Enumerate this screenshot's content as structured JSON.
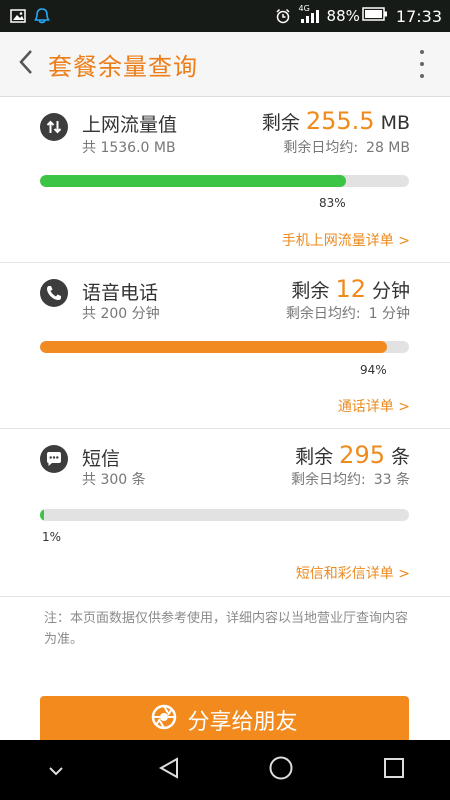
{
  "status_bar": {
    "signal_label": "4G",
    "battery": "88%",
    "time": "17:33"
  },
  "app_bar": {
    "title": "套餐余量查询"
  },
  "data_section": {
    "name": "上网流量值",
    "total": "共 1536.0 MB",
    "remain_label": "剩余",
    "remain_value": "255.5",
    "remain_unit": "MB",
    "avg_label": "剩余日均约:",
    "avg_value": "28 MB",
    "used_fraction": 0.83,
    "percent_text": "83%",
    "detail_link": "手机上网流量详单 >",
    "icon": "updown-arrows-icon"
  },
  "voice_section": {
    "name": "语音电话",
    "total": "共 200 分钟",
    "remain_label": "剩余",
    "remain_value": "12",
    "remain_unit": "分钟",
    "avg_label": "剩余日均约:",
    "avg_value": "1 分钟",
    "used_fraction": 0.94,
    "percent_text": "94%",
    "detail_link": "通话详单 >",
    "icon": "phone-icon"
  },
  "sms_section": {
    "name": "短信",
    "total": "共 300 条",
    "remain_label": "剩余",
    "remain_value": "295",
    "remain_unit": "条",
    "avg_label": "剩余日均约:",
    "avg_value": "33 条",
    "used_fraction": 0.01,
    "percent_text": "1%",
    "detail_link": "短信和彩信详单 >",
    "icon": "chat-bubble-icon"
  },
  "note": "注：本页面数据仅供参考使用，详细内容以当地营业厅查询内容为准。",
  "share_button": {
    "label": "分享给朋友",
    "icon": "aperture-icon"
  },
  "colors": {
    "accent": "#ec7d17",
    "progress_green": "#3cc444",
    "progress_orange": "#f28a22"
  }
}
